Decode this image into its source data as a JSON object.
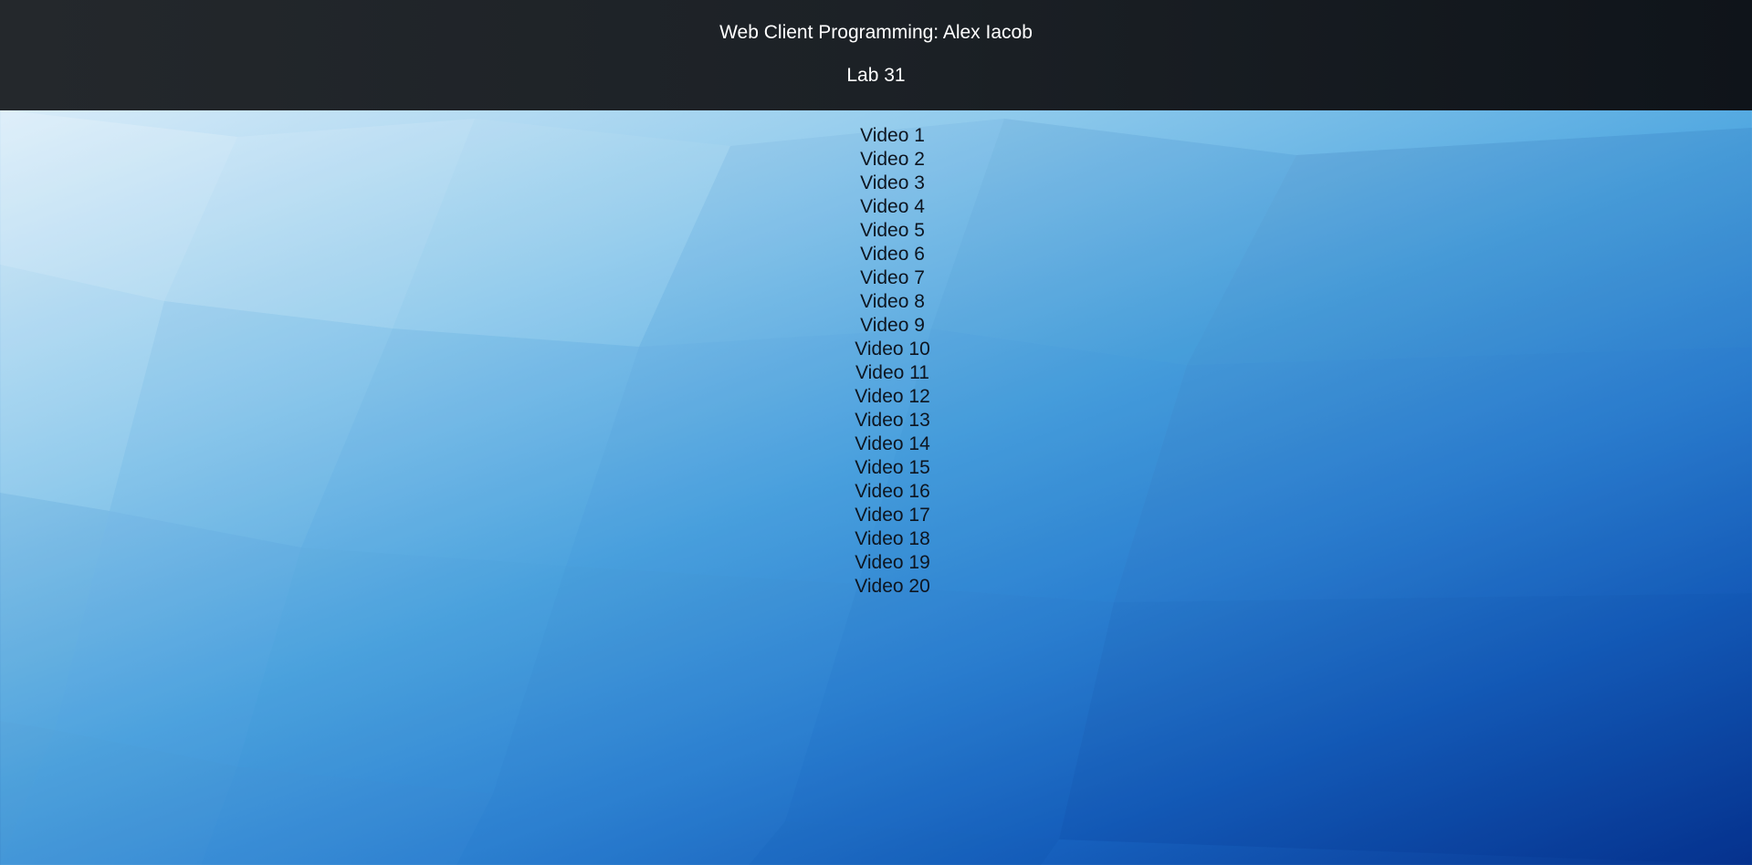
{
  "header": {
    "title": "Web Client Programming: Alex Iacob",
    "subtitle": "Lab 31"
  },
  "videos": [
    "Video 1",
    "Video 2",
    "Video 3",
    "Video 4",
    "Video 5",
    "Video 6",
    "Video 7",
    "Video 8",
    "Video 9",
    "Video 10",
    "Video 11",
    "Video 12",
    "Video 13",
    "Video 14",
    "Video 15",
    "Video 16",
    "Video 17",
    "Video 18",
    "Video 19",
    "Video 20"
  ],
  "colors": {
    "header_bg": "#1c2126",
    "header_text": "#ffffff",
    "list_text": "#0d1520",
    "background_light": "#eef6fd",
    "background_dark": "#06338f"
  }
}
